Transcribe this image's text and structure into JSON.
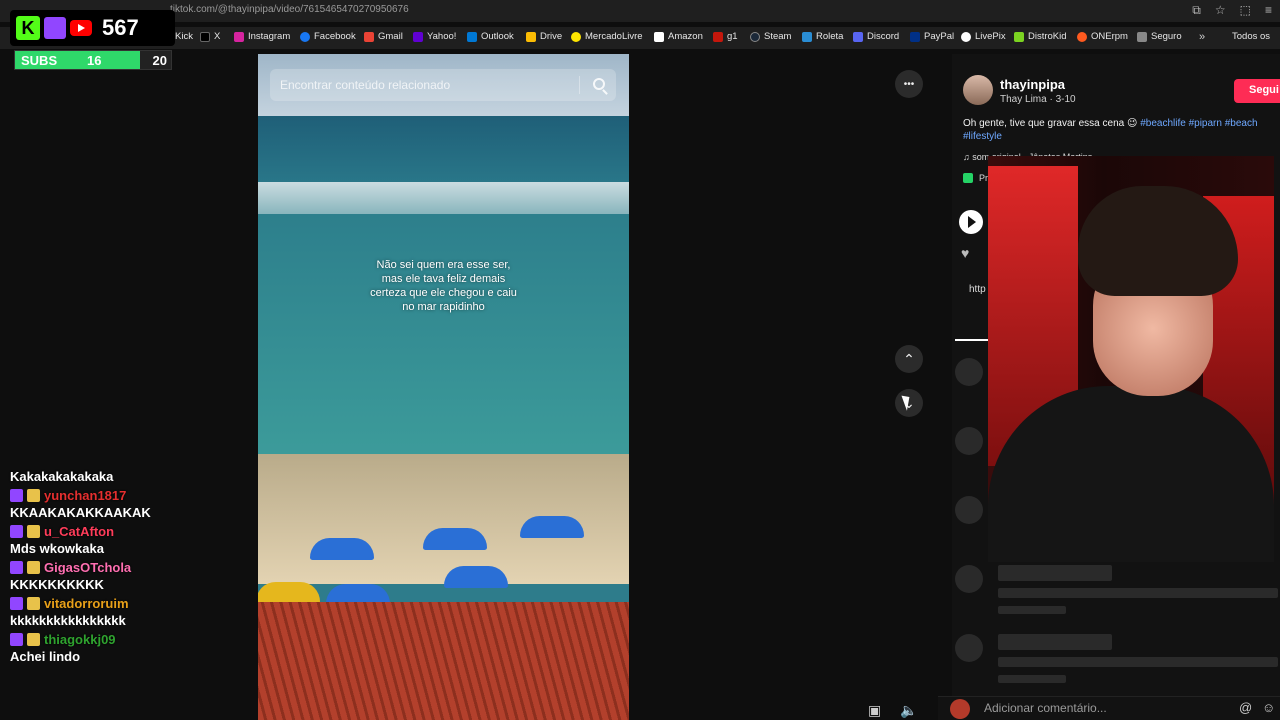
{
  "browser": {
    "url": "tiktok.com/@thayinpipa/video/7615465470270950676",
    "bookmarks": [
      "Kick",
      "X",
      "Instagram",
      "Facebook",
      "Gmail",
      "Yahoo!",
      "Outlook",
      "Drive",
      "MercadoLivre",
      "Amazon",
      "g1",
      "Steam",
      "Roleta",
      "Discord",
      "PayPal",
      "LivePix",
      "DistroKid",
      "ONErpm",
      "Seguro"
    ],
    "more": "»",
    "folder": "Todos os"
  },
  "overlay": {
    "kick_letter": "K",
    "viewers": "567",
    "subs_label": "SUBS",
    "subs_current": "16",
    "subs_goal": "20",
    "subs_progress": 0.8
  },
  "chat": {
    "top_message": "Kakakakakakaka",
    "messages": [
      {
        "user": "yunchan1817",
        "color": "#e62f2f",
        "text": "KKAAKAKAKKAAKAK"
      },
      {
        "user": "u_CatAfton",
        "color": "#ff3d5a",
        "text": "Mds wkowkaka"
      },
      {
        "user": "GigasOTchola",
        "color": "#ff6fb1",
        "text": "KKKKKKKKKK"
      },
      {
        "user": "vitadorroruim",
        "color": "#e8a019",
        "text": "kkkkkkkkkkkkkkkk"
      },
      {
        "user": "thiagokkj09",
        "color": "#2fa32f",
        "text": "Achei lindo"
      }
    ]
  },
  "search": {
    "placeholder": "Encontrar conteúdo relacionado"
  },
  "video": {
    "caption_lines": [
      "Não sei quem era esse ser,",
      "mas ele tava feliz demais",
      "certeza que ele chegou e caiu",
      "no mar rapidinho"
    ]
  },
  "controls": {
    "more_icon": "•••",
    "up_icon": "⌃",
    "down_icon": "⌄"
  },
  "post": {
    "username": "thayinpipa",
    "subline": "Thay Lima · 3-10",
    "follow_label": "Segui",
    "caption_text": "Oh gente, tive que gravar essa cena 😉",
    "hashtags": [
      "#beachlife",
      "#piparn",
      "#beach",
      "#lifestyle"
    ],
    "sound": "♫  som original - Jônatas Martins",
    "pr_text": "Pr",
    "link_text": "http"
  },
  "comment": {
    "placeholder": "Adicionar comentário...",
    "at_icon": "@",
    "emoji_icon": "☺"
  }
}
